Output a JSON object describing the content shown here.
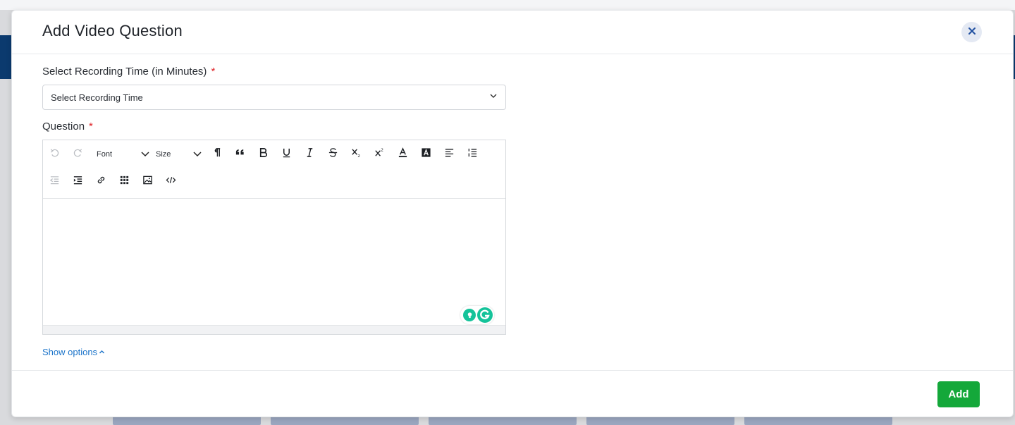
{
  "modal": {
    "title": "Add Video Question",
    "close_icon": "close-icon"
  },
  "recording_time": {
    "label": "Select Recording Time (in Minutes)",
    "required_mark": "*",
    "selected_value": "Select Recording Time"
  },
  "question": {
    "label": "Question",
    "required_mark": "*",
    "toolbar": {
      "font_label": "Font",
      "size_label": "Size",
      "buttons_row1": [
        "undo-icon",
        "redo-icon",
        "paragraph-icon",
        "blockquote-icon",
        "bold-icon",
        "underline-icon",
        "italic-icon",
        "strikethrough-icon",
        "subscript-icon",
        "superscript-icon",
        "font-color-icon",
        "highlight-color-icon",
        "align-icon",
        "list-icon"
      ],
      "buttons_row2": [
        "outdent-icon",
        "indent-icon",
        "link-icon",
        "table-icon",
        "image-icon",
        "code-view-icon"
      ]
    },
    "content": ""
  },
  "show_options": {
    "label": "Show options"
  },
  "footer": {
    "add_label": "Add"
  },
  "colors": {
    "primary_button": "#14a83a",
    "link": "#1a73c9",
    "required": "#e0262b",
    "header_band": "#0b3a6e",
    "grammarly": "#15c39a"
  }
}
